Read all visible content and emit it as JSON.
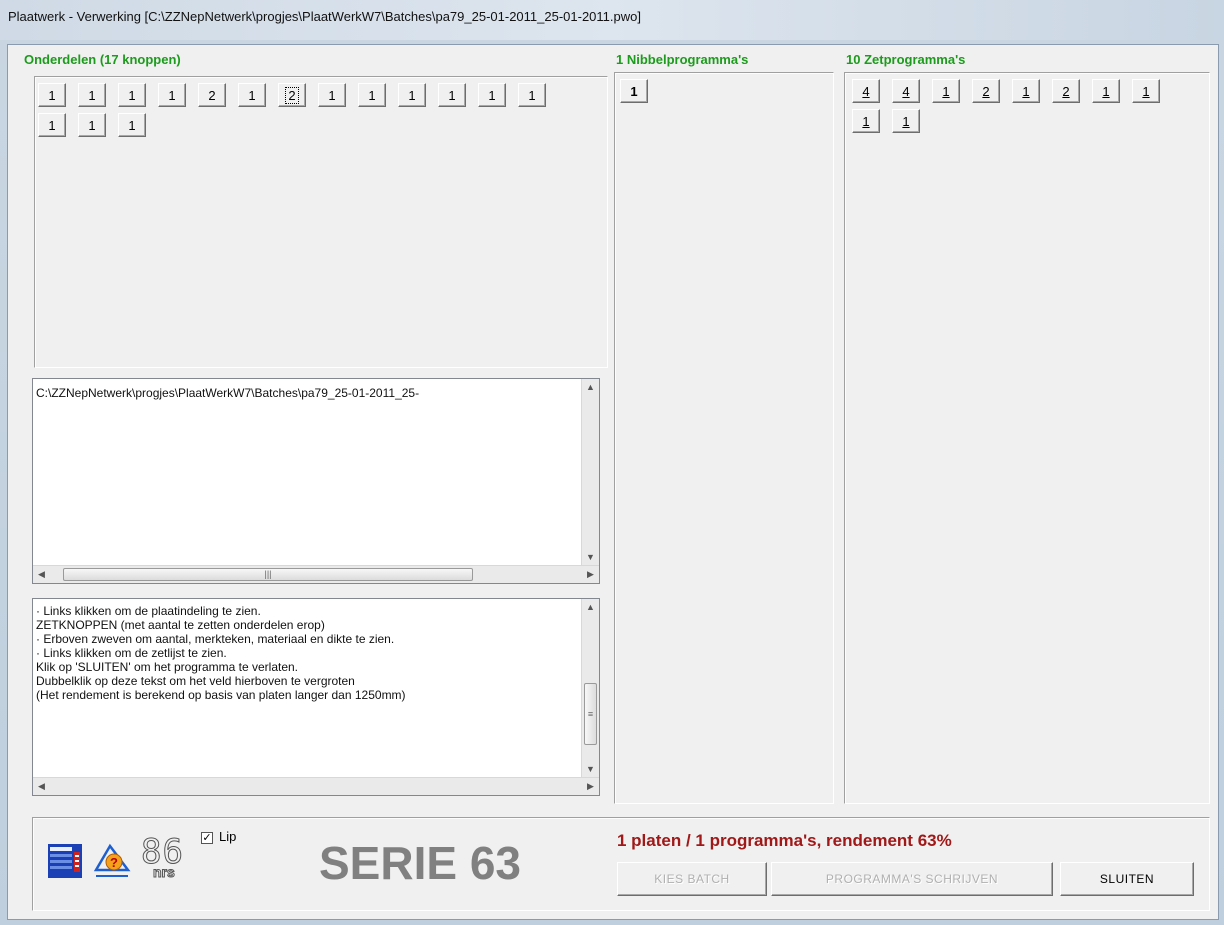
{
  "window": {
    "title": "Plaatwerk - Verwerking  [C:\\ZZNepNetwerk\\progjes\\PlaatWerkW7\\Batches\\pa79_25-01-2011_25-01-2011.pwo]"
  },
  "onderdelen": {
    "label": "Onderdelen (17 knoppen)",
    "buttons": [
      "1",
      "1",
      "1",
      "1",
      "2",
      "1",
      "2",
      "1",
      "1",
      "1",
      "1",
      "1",
      "1",
      "1",
      "1",
      "1"
    ]
  },
  "nibbel": {
    "label": "1 Nibbelprogramma's",
    "buttons": [
      "1"
    ]
  },
  "zet": {
    "label": "10 Zetprogramma's",
    "buttons": [
      "4",
      "4",
      "1",
      "2",
      "1",
      "2",
      "1",
      "1",
      "1",
      "1"
    ]
  },
  "path_box": {
    "text": "C:\\ZZNepNetwerk\\progjes\\PlaatWerkW7\\Batches\\pa79_25-01-2011_25-"
  },
  "help_box": {
    "lines": [
      "   · Links klikken om de plaatindeling te zien.",
      "ZETKNOPPEN (met aantal te zetten onderdelen erop)",
      "   · Erboven zweven om aantal, merkteken, materiaal en dikte te zien.",
      "   · Links klikken om de zetlijst te zien.",
      "Klik op 'SLUITEN' om het programma te verlaten.",
      "Dubbelklik op deze tekst om het veld hierboven te vergroten",
      "(Het rendement is berekend op basis van platen langer dan 1250mm)"
    ]
  },
  "bottom": {
    "counter_digits": "86",
    "counter_unit": "nrs",
    "lip_label": "Lip",
    "lip_checked": true,
    "serie_label": "SERIE 63",
    "status": "1 platen / 1 programma's, rendement 63%",
    "kies_batch": "KIES BATCH",
    "programmas_schrijven": "PROGRAMMA'S SCHRIJVEN",
    "sluiten": "SLUITEN"
  },
  "colors": {
    "panel_label": "#1c9b1c",
    "status_text": "#a01818",
    "serie_text": "#808080"
  },
  "icons": [
    "calculator-icon",
    "help-triangle-icon",
    "digital-counter-icon"
  ]
}
